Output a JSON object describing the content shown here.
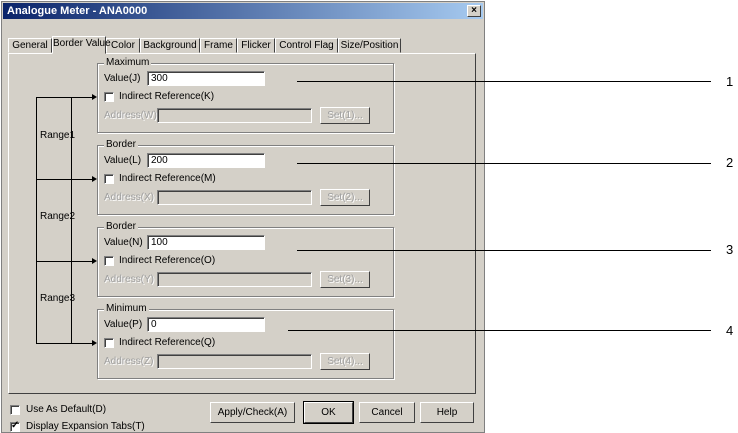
{
  "window": {
    "title": "Analogue Meter - ANA0000",
    "close_label": "×"
  },
  "tabs": [
    {
      "label": "General"
    },
    {
      "label": "Border Value",
      "active": true
    },
    {
      "label": "Color"
    },
    {
      "label": "Background"
    },
    {
      "label": "Frame"
    },
    {
      "label": "Flicker"
    },
    {
      "label": "Control Flag"
    },
    {
      "label": "Size/Position"
    }
  ],
  "groups": [
    {
      "title": "Maximum",
      "value_label": "Value(J)",
      "value": "300",
      "indirect_label": "Indirect Reference(K)",
      "address_label": "Address(W)",
      "set_label": "Set(1)..."
    },
    {
      "title": "Border",
      "value_label": "Value(L)",
      "value": "200",
      "indirect_label": "Indirect Reference(M)",
      "address_label": "Address(X)",
      "set_label": "Set(2)..."
    },
    {
      "title": "Border",
      "value_label": "Value(N)",
      "value": "100",
      "indirect_label": "Indirect Reference(O)",
      "address_label": "Address(Y)",
      "set_label": "Set(3)..."
    },
    {
      "title": "Minimum",
      "value_label": "Value(P)",
      "value": "0",
      "indirect_label": "Indirect Reference(Q)",
      "address_label": "Address(Z)",
      "set_label": "Set(4)..."
    }
  ],
  "ranges": [
    "Range1",
    "Range2",
    "Range3"
  ],
  "callouts": [
    "1",
    "2",
    "3",
    "4"
  ],
  "footer": {
    "use_as_default": {
      "label": "Use As Default(D)",
      "checked": false
    },
    "display_tabs": {
      "label": "Display Expansion Tabs(T)",
      "checked": true
    },
    "buttons": {
      "apply": "Apply/Check(A)",
      "ok": "OK",
      "cancel": "Cancel",
      "help": "Help"
    }
  }
}
